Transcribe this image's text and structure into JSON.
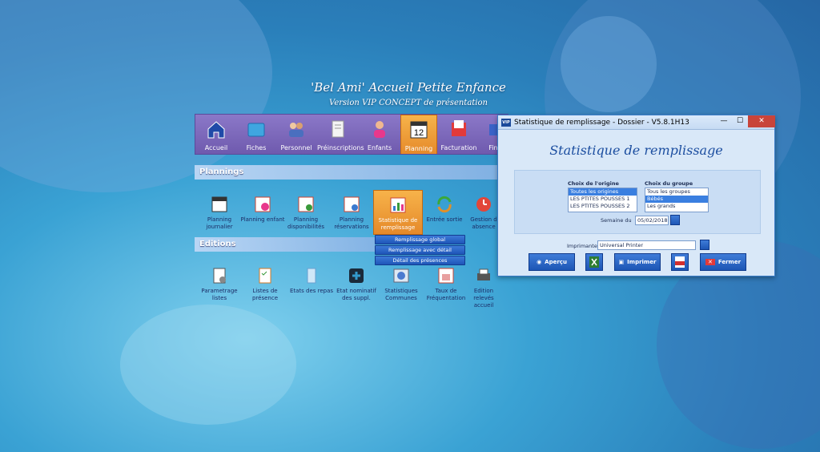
{
  "app": {
    "title": "'Bel Ami' Accueil Petite Enfance",
    "subtitle": "Version VIP CONCEPT de présentation"
  },
  "topnav": {
    "items": [
      {
        "label": "Accueil",
        "icon": "home-icon"
      },
      {
        "label": "Fiches",
        "icon": "folder-icon"
      },
      {
        "label": "Personnel",
        "icon": "people-icon"
      },
      {
        "label": "Préinscriptions",
        "icon": "document-icon"
      },
      {
        "label": "Enfants",
        "icon": "child-icon"
      },
      {
        "label": "Planning",
        "icon": "calendar-icon",
        "selected": true,
        "day": "12"
      },
      {
        "label": "Facturation",
        "icon": "invoice-icon"
      },
      {
        "label": "Finar",
        "icon": "finance-icon"
      }
    ]
  },
  "sections": {
    "plannings": "Plannings",
    "editions": "Editions"
  },
  "plannings": [
    {
      "label": "Planning journalier",
      "icon": "calendar-icon"
    },
    {
      "label": "Planning enfant",
      "icon": "child-calendar-icon"
    },
    {
      "label": "Planning disponibilités",
      "icon": "availability-icon"
    },
    {
      "label": "Planning réservations",
      "icon": "reservation-icon"
    },
    {
      "label": "Statistique de remplissage",
      "icon": "statistics-icon",
      "selected": true
    },
    {
      "label": "Entrée sortie",
      "icon": "refresh-icon"
    },
    {
      "label": "Gestion d absence",
      "icon": "clock-icon"
    }
  ],
  "dropdown": [
    "Remplissage global",
    "Remplissage avec détail",
    "Détail des présences"
  ],
  "editions": [
    {
      "label": "Parametrage listes",
      "icon": "settings-list-icon"
    },
    {
      "label": "Listes de présence",
      "icon": "checklist-icon"
    },
    {
      "label": "Etats des repas",
      "icon": "meal-icon"
    },
    {
      "label": "Etat nominatif des suppl.",
      "icon": "plus-icon"
    },
    {
      "label": "Statistiques Communes",
      "icon": "chart-icon"
    },
    {
      "label": "Taux de Fréquentation",
      "icon": "rate-icon"
    },
    {
      "label": "Edition relevés accueil",
      "icon": "print-icon"
    }
  ],
  "dialog": {
    "titlebar": "Statistique de remplissage  -  Dossier  -  V5.8.1H13",
    "heading": "Statistique de remplissage",
    "origin_label": "Choix de l'origine",
    "origin_items": [
      "Toutes les origines",
      "LES PTITES POUSSES 1",
      "LES PTITES POUSSES 2"
    ],
    "group_label": "Choix du groupe",
    "group_items": [
      "Tous les groupes",
      "Bébés",
      "Les grands"
    ],
    "week_label": "Semaine du",
    "week_value": "05/02/2018",
    "printer_label": "Imprimante",
    "printer_value": "Universal Printer",
    "preview_label": "Aperçu",
    "print_label": "Imprimer",
    "close_label": "Fermer"
  }
}
